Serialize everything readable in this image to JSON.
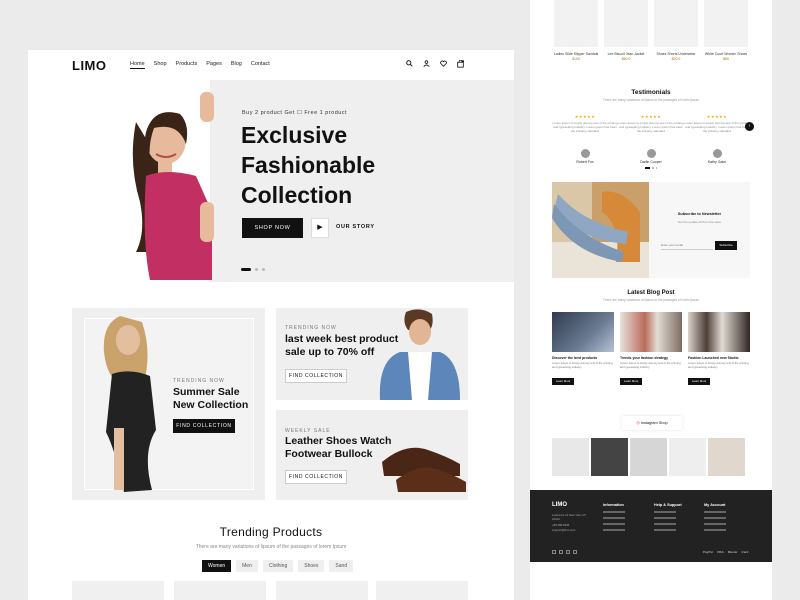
{
  "left_page": {
    "nav": {
      "logo": "LIMO",
      "menu": [
        "Home",
        "Shop",
        "Products",
        "Pages",
        "Blog",
        "Contact"
      ],
      "icons": [
        "search-icon",
        "user-icon",
        "heart-icon",
        "bag-icon"
      ]
    },
    "hero": {
      "kicker": "Buy 2 product Get ☐ Free 1 product",
      "title_line1": "Exclusive",
      "title_line2": "Fashionable",
      "title_line3": "Collection",
      "shop_now": "SHOP NOW",
      "play_icon": "▶",
      "our_story": "OUR STORY"
    },
    "promo_main": {
      "kicker": "TRENDING NOW",
      "title_line1": "Summer Sale",
      "title_line2": "New Collection",
      "button": "FIND COLLECTION"
    },
    "promo_top": {
      "kicker": "TRENDING NOW",
      "title_line1": "last week best product",
      "title_line2": "sale up to 70% off",
      "button": "FIND COLLECTION"
    },
    "promo_bottom": {
      "kicker": "WEEKLY SALE",
      "title_line1": "Leather Shoes Watch",
      "title_line2": "Footwear Bullock",
      "button": "FIND COLLECTION"
    },
    "trending": {
      "title": "Trending Products",
      "subtitle": "There are many variations of lipsum of the passages of lorem Ipsum",
      "tabs": [
        "Women",
        "Men",
        "Clothing",
        "Shoes",
        "Sand"
      ]
    }
  },
  "right_page": {
    "products": [
      {
        "name": "Ladies Slide Slipper Sandals",
        "price": "$100"
      },
      {
        "name": "Lee Biscuit Jean Jacket",
        "price": "$50.0"
      },
      {
        "name": "Shoes Shorts Underwear",
        "price": "$20.0"
      },
      {
        "name": "White Court Women Shoes",
        "price": "$60"
      }
    ],
    "testimonials": {
      "title": "Testimonials",
      "subtitle": "There are many variations of lipsum of the passages of lorem Ipsum",
      "stars": "★★★★★",
      "items": [
        {
          "text": "Lorem ipsum is simply dummy text of the printing and typesetting industry. Lorem ipsum has been the industry standard",
          "name": "Robert Fox"
        },
        {
          "text": "Lorem ipsum is simply dummy text of the printing and typesetting industry. Lorem ipsum has been the industry standard",
          "name": "Darlin Cooper"
        },
        {
          "text": "Lorem ipsum is simply dummy text of the printing and typesetting industry. Lorem ipsum has been the industry standard",
          "name": "Kathy Gaim"
        }
      ]
    },
    "newsletter": {
      "title": "Subscribe to Newsletter",
      "subtitle": "Get the update off from the store",
      "placeholder": "Enter your email",
      "button": "Subscribe"
    },
    "blog": {
      "title": "Latest Blog Post",
      "subtitle": "There are many variations of lipsum of the passages of lorem Ipsum",
      "posts": [
        {
          "title": "Discover the best products",
          "text": "Lorem ipsum is simply dummy text of the printing and typesetting industry",
          "button": "Learn More"
        },
        {
          "title": "Trends your fashion strategy",
          "text": "Lorem ipsum is simply dummy text of the printing and typesetting industry",
          "button": "Learn More"
        },
        {
          "title": "Fashion Launched new Studio",
          "text": "Lorem ipsum is simply dummy text of the printing and typesetting industry",
          "button": "Learn More"
        }
      ]
    },
    "instagram": {
      "label": "Instagram Shop"
    },
    "footer": {
      "logo": "LIMO",
      "address": "Lesbonne 14 New York, NY 10010",
      "phone": "+86 589 6945",
      "email": "support@limo.com",
      "columns": [
        "Information",
        "Help & Support",
        "My Account"
      ],
      "payments": [
        "PayPal",
        "VISA",
        "Master",
        "Card"
      ]
    }
  },
  "colors": {
    "background": "#ebebeb",
    "dark": "#111111",
    "panel": "#efefef",
    "price": "#b06a1e",
    "star": "#f2a900"
  }
}
